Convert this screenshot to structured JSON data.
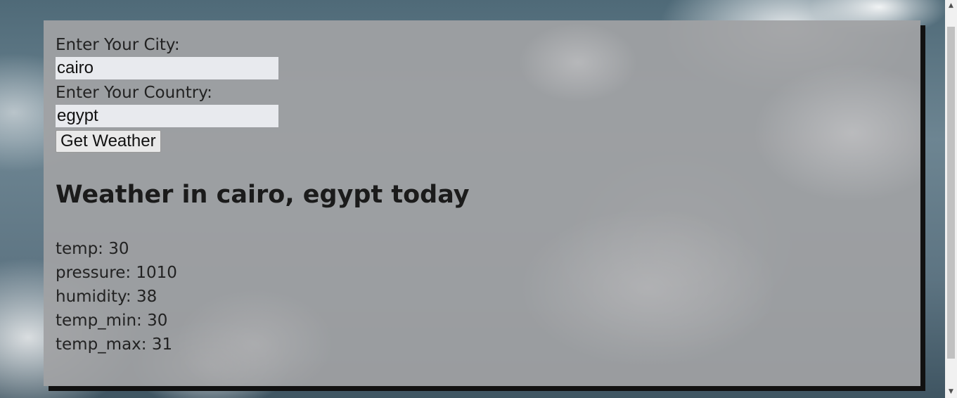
{
  "form": {
    "city_label": "Enter Your City:",
    "city_value": "cairo",
    "country_label": "Enter Your Country:",
    "country_value": "egypt",
    "submit_label": "Get Weather"
  },
  "result": {
    "title": "Weather in cairo, egypt today",
    "stats": [
      "temp: 30",
      "pressure: 1010",
      "humidity: 38",
      "temp_min: 30",
      "temp_max: 31"
    ]
  },
  "scrollbar": {
    "up_icon": "triangle-up",
    "down_icon": "triangle-down"
  }
}
